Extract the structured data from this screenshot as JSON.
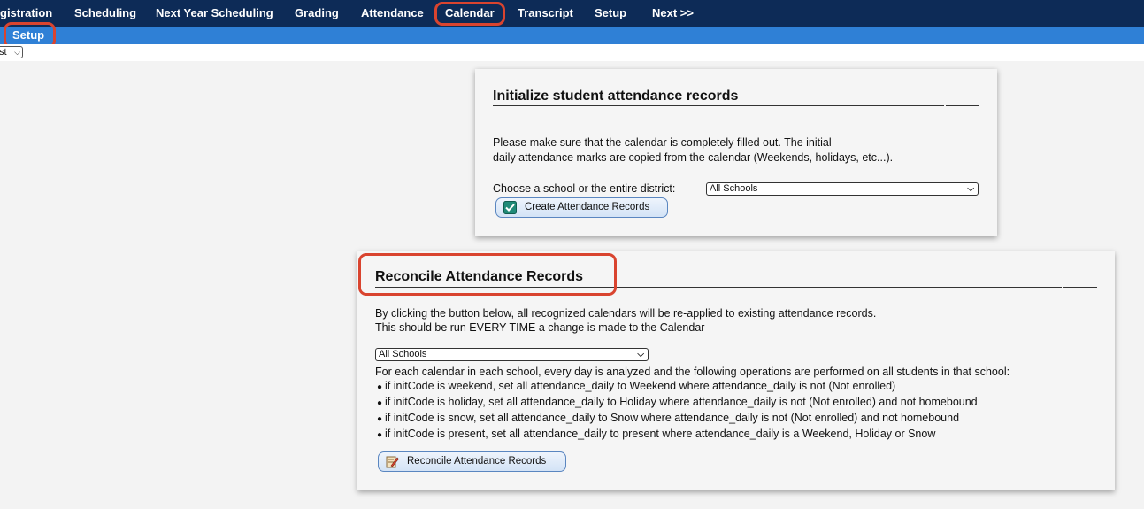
{
  "topnav": {
    "items": [
      "gistration",
      "Scheduling",
      "Next Year Scheduling",
      "Grading",
      "Attendance",
      "Calendar",
      "Transcript",
      "Setup",
      "Next >>"
    ]
  },
  "subnav": {
    "setup_label": "Setup"
  },
  "mini_select": {
    "value": "st"
  },
  "init_card": {
    "title": "Initialize student attendance records",
    "line1": "Please make sure that the calendar is completely filled out. The initial",
    "line2": "daily attendance marks are copied from the calendar (Weekends, holidays, etc...).",
    "choose_label": "Choose a school or the entire district:",
    "school_select": "All Schools",
    "button_label": "Create Attendance Records"
  },
  "reconcile_card": {
    "title": "Reconcile Attendance Records",
    "line1": "By clicking the button below, all recognized calendars will be re-applied to existing attendance records.",
    "line2": "This should be run EVERY TIME a change is made to the Calendar",
    "school_select": "All Schools",
    "intro": "For each calendar in each school, every day is analyzed and the following operations are performed on all students in that school:",
    "ops": [
      "if initCode is weekend, set all attendance_daily to Weekend where attendance_daily is not (Not enrolled)",
      "if initCode is holiday, set all attendance_daily to Holiday where attendance_daily is not (Not enrolled) and not homebound",
      "if initCode is snow, set all attendance_daily to Snow where attendance_daily is not (Not enrolled) and not homebound",
      "if initCode is present, set all attendance_daily to present where attendance_daily is a Weekend, Holiday or Snow"
    ],
    "button_label": "Reconcile Attendance Records"
  },
  "colors": {
    "topnav": "#0d2b57",
    "subnav": "#2f80d6",
    "highlight": "#d9442f"
  }
}
